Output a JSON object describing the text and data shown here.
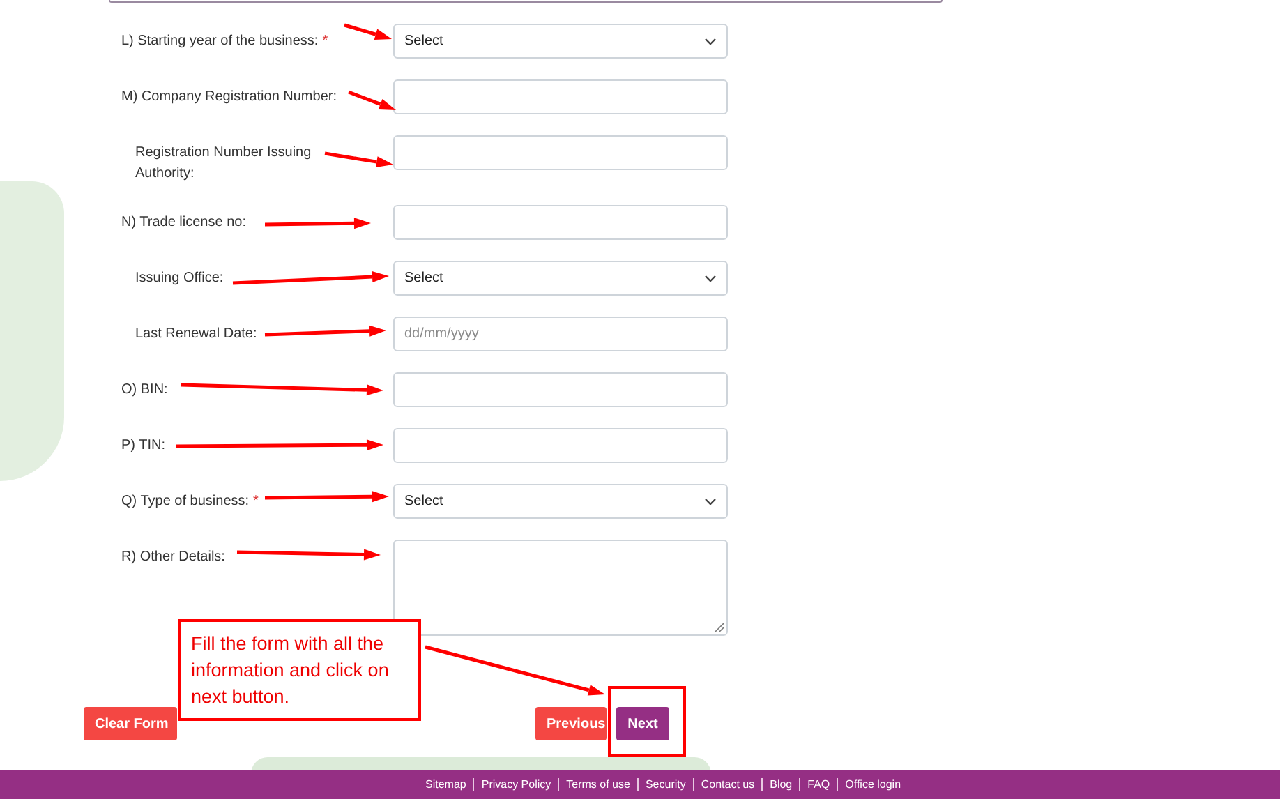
{
  "form": {
    "fields": [
      {
        "label": "L) Starting year of the business:",
        "required_mark": "*",
        "kind": "select",
        "value": "Select"
      },
      {
        "label": "M) Company Registration Number:",
        "kind": "text",
        "children": [
          {
            "label": "Registration Number Issuing Authority:",
            "kind": "text"
          }
        ]
      },
      {
        "label": "N) Trade license no:",
        "kind": "text",
        "children": [
          {
            "label": "Issuing Office:",
            "kind": "select",
            "value": "Select"
          },
          {
            "label": "Last Renewal Date:",
            "kind": "date",
            "placeholder": "dd/mm/yyyy"
          }
        ]
      },
      {
        "label": "O) BIN:",
        "kind": "text"
      },
      {
        "label": "P) TIN:",
        "kind": "text"
      },
      {
        "label": "Q) Type of business:",
        "required_mark": "*",
        "kind": "select",
        "value": "Select"
      },
      {
        "label": "R) Other Details:",
        "kind": "textarea"
      }
    ],
    "buttons": [
      {
        "label": "Clear Form",
        "kind": "clear"
      },
      {
        "label": "Previous",
        "kind": "previous"
      },
      {
        "label": "Next",
        "kind": "next"
      }
    ]
  },
  "annotation": {
    "text": "Fill the form with all the information and click on next button."
  },
  "footer": {
    "links": [
      "Sitemap",
      "Privacy Policy",
      "Terms of use",
      "Security",
      "Contact us",
      "Blog",
      "FAQ",
      "Office login"
    ]
  }
}
